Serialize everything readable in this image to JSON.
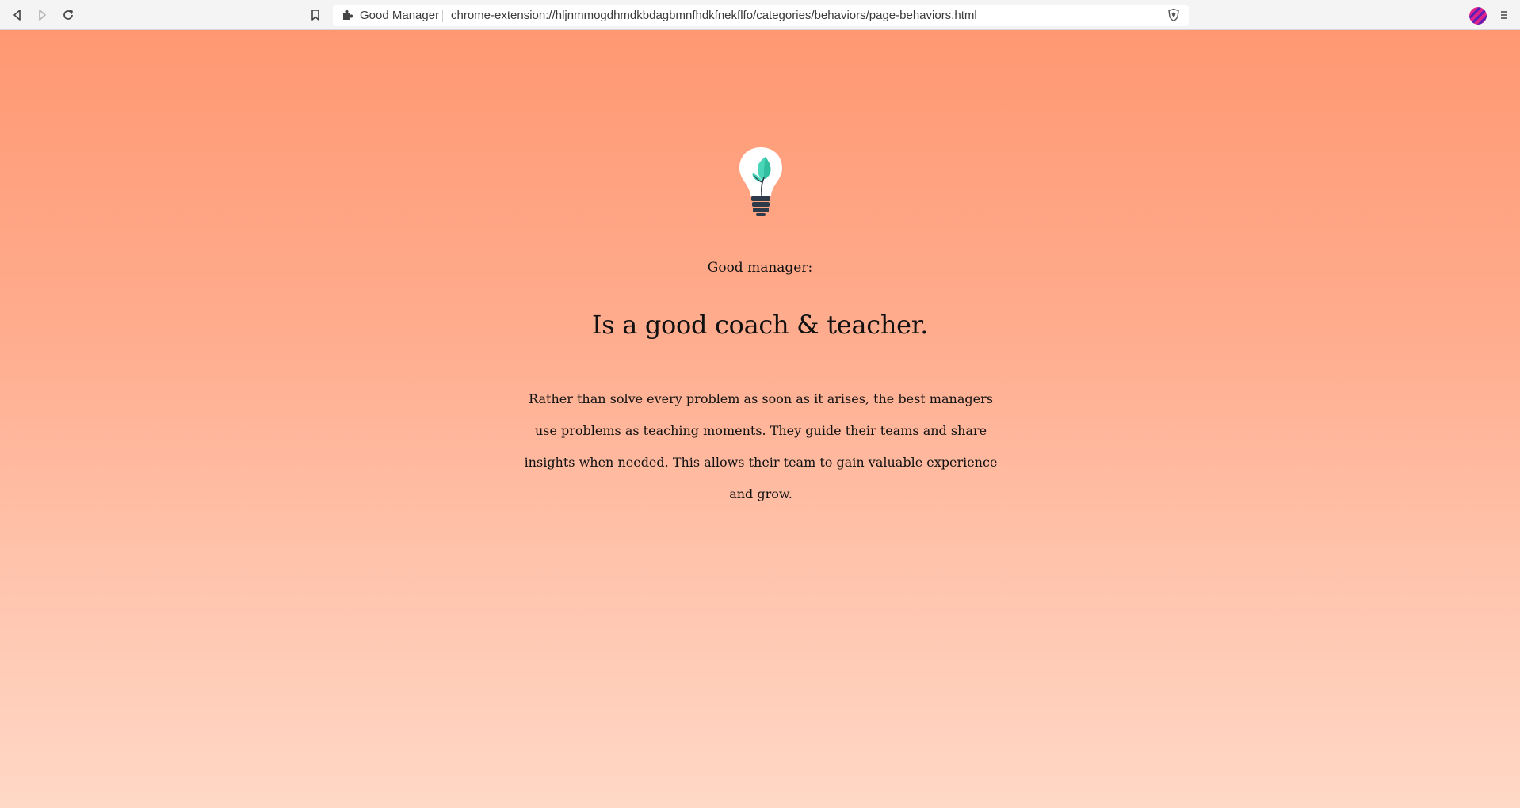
{
  "browser": {
    "tab_title": "Good Manager",
    "url": "chrome-extension://hljnmmogdhmdkbdagbmnfhdkfnekflfo/categories/behaviors/page-behaviors.html",
    "icons": {
      "back": "back-arrow-icon",
      "forward": "forward-arrow-icon",
      "reload": "reload-icon",
      "bookmark": "bookmark-icon",
      "extension": "puzzle-piece-icon",
      "shield": "brave-shield-icon",
      "profile": "profile-avatar-icon",
      "menu": "hamburger-menu-icon"
    }
  },
  "page": {
    "background_top": "#ff9872",
    "background_bottom": "#ffd8c6",
    "illustration": "lightbulb-with-sprout-icon",
    "eyebrow": "Good manager:",
    "headline": "Is a good coach & teacher.",
    "body": "Rather than solve every problem as soon as it arises, the best managers use problems as teaching moments. They guide their teams and share insights when needed. This allows their team to gain valuable experience and grow."
  }
}
